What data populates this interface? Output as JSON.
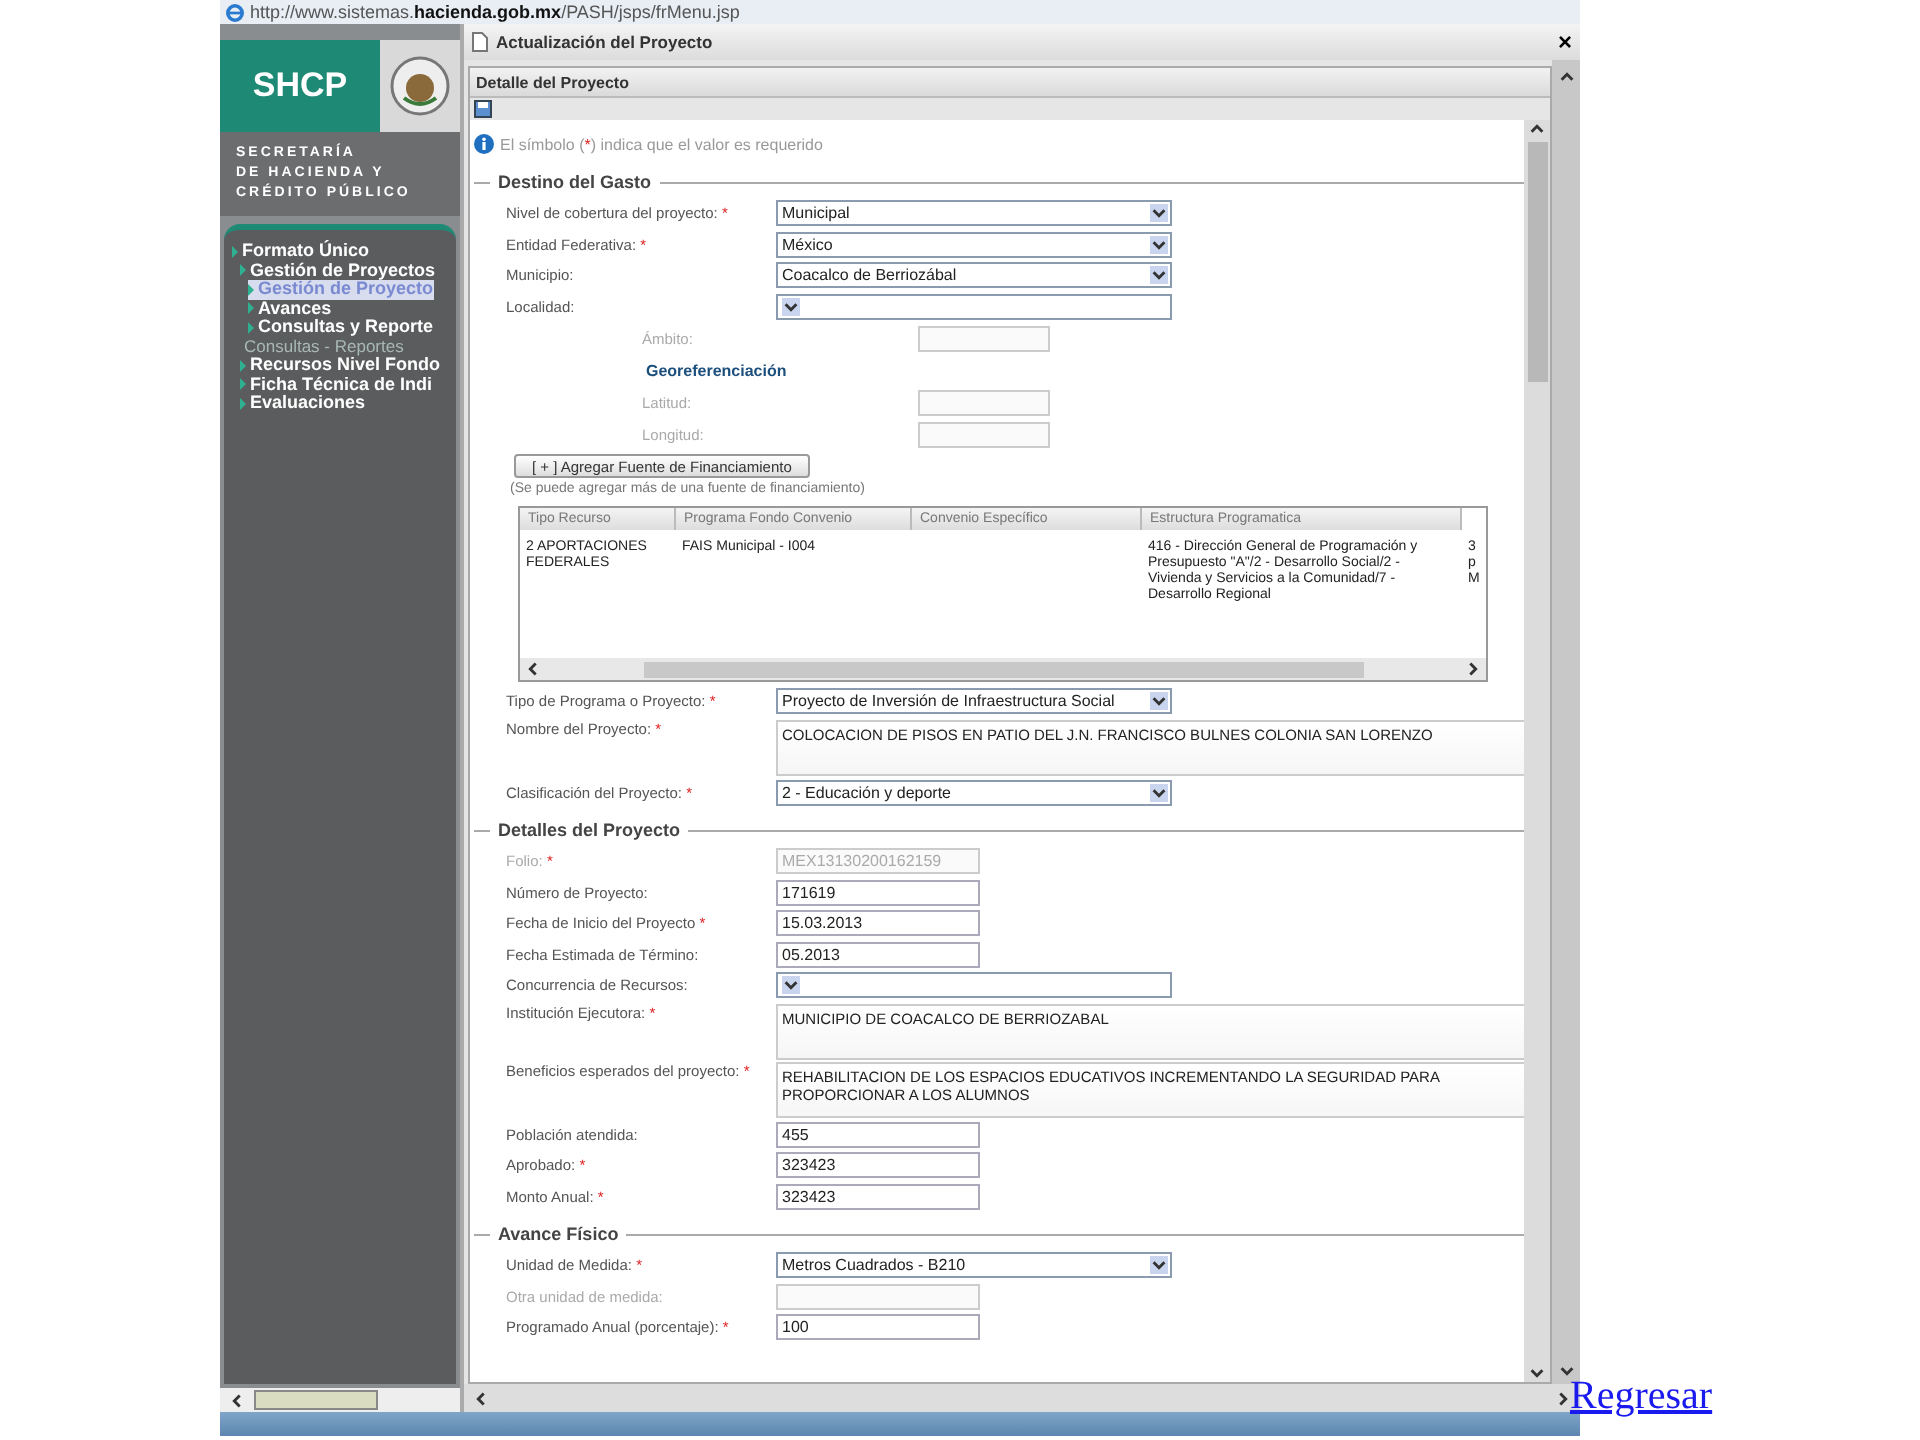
{
  "browser": {
    "url": "http://www.sistemas.**hacienda.gob.mx**/PASH/jsps/frMenu.jsp"
  },
  "sidebar": {
    "logo": "SHCP",
    "agency": [
      "SECRETARÍA",
      "DE HACIENDA Y",
      "CRÉDITO PÚBLICO"
    ],
    "menu": [
      {
        "label": "Formato Único",
        "kind": "link",
        "selected": false,
        "children": [
          {
            "label": "Gestión de Proyectos",
            "kind": "link",
            "selected": false,
            "children": [
              {
                "label": "Gestión de Proyecto",
                "kind": "link",
                "selected": true
              },
              {
                "label": "Avances",
                "kind": "link",
                "selected": false
              },
              {
                "label": "Consultas y Reporte",
                "kind": "link",
                "selected": false
              }
            ]
          },
          {
            "label": "Consultas - Reportes",
            "kind": "section",
            "selected": false
          },
          {
            "label": "Recursos Nivel Fondo",
            "kind": "link",
            "selected": false
          },
          {
            "label": "Ficha Técnica de Indi",
            "kind": "link",
            "selected": false
          },
          {
            "label": "Evaluaciones",
            "kind": "link",
            "selected": false
          }
        ]
      }
    ]
  },
  "dialog": {
    "title": "Actualización del Proyecto",
    "close": "×",
    "panel_title": "Detalle del Proyecto",
    "note": {
      "before": "El símbolo (",
      "mark": "*",
      "after": ") indica que el valor es requerido"
    },
    "sections": [
      {
        "title": "Destino del Gasto",
        "items": [
          {
            "kind": "select",
            "label": "Nivel de cobertura del proyecto:",
            "mark": "*",
            "value": "Municipal"
          },
          {
            "kind": "select",
            "label": "Entidad Federativa:",
            "mark": "*",
            "value": "México"
          },
          {
            "kind": "select",
            "label": "Municipio:",
            "value": "Coacalco de Berriozábal"
          },
          {
            "kind": "select",
            "label": "Localidad:"
          },
          {
            "kind": "subinput",
            "label": "Ámbito:",
            "disabled": true
          },
          {
            "kind": "subheading",
            "label": "Georeferenciación"
          },
          {
            "kind": "subinput",
            "label": "Latitud:",
            "disabled": true
          },
          {
            "kind": "subinput",
            "label": "Longitud:",
            "disabled": true
          },
          {
            "kind": "button",
            "label": "[ + ] Agregar Fuente de Financiamiento"
          },
          {
            "kind": "hint",
            "label": "(Se puede agregar más de una fuente de financiamiento)"
          },
          {
            "kind": "table",
            "columns": [
              "Tipo Recurso",
              "Programa Fondo Convenio",
              "Convenio Específico",
              "Estructura Programatica"
            ],
            "rows": [
              {
                "cells": [
                  "2  APORTACIONES FEDERALES",
                  "FAIS Municipal - I004",
                  null,
                  "416 - Dirección General de Programación y Presupuesto \"A\"/2 - Desarrollo Social/2 - Vivienda y Servicios a la Comunidad/7 - Desarrollo Regional",
                  "3\np\nM"
                ]
              }
            ]
          },
          {
            "kind": "select",
            "label": "Tipo de Programa o Proyecto:",
            "mark": "*",
            "value": "Proyecto de Inversión de Infraestructura Social"
          },
          {
            "kind": "textarea",
            "label": "Nombre del Proyecto:",
            "mark": "*",
            "value": "COLOCACION DE PISOS EN PATIO DEL J.N. FRANCISCO BULNES COLONIA SAN LORENZO"
          },
          {
            "kind": "select",
            "label": "Clasificación del Proyecto:",
            "mark": "*",
            "value": "2 - Educación y deporte"
          }
        ]
      },
      {
        "title": "Detalles del Proyecto",
        "items": [
          {
            "kind": "input",
            "label": "Folio:",
            "mark": "*",
            "value": "MEX13130200162159",
            "disabled": true
          },
          {
            "kind": "input",
            "label": "Número de Proyecto:",
            "value": "171619"
          },
          {
            "kind": "input",
            "label": "Fecha de Inicio del Proyecto",
            "mark": "*",
            "value": "15.03.2013"
          },
          {
            "kind": "input",
            "label": "Fecha Estimada de Término:",
            "value": "05.2013"
          },
          {
            "kind": "select",
            "label": "Concurrencia de Recursos:"
          },
          {
            "kind": "textarea",
            "label": "Institución Ejecutora:",
            "mark": "*",
            "value": "MUNICIPIO DE COACALCO DE BERRIOZABAL"
          },
          {
            "kind": "textarea",
            "label": "Beneficios esperados del proyecto:",
            "mark": "*",
            "value": "REHABILITACION DE LOS ESPACIOS EDUCATIVOS INCREMENTANDO LA SEGURIDAD PARA PROPORCIONAR A LOS ALUMNOS"
          },
          {
            "kind": "input",
            "label": "Población atendida:",
            "value": "455"
          },
          {
            "kind": "input",
            "label": "Aprobado:",
            "mark": "*",
            "value": "323423"
          },
          {
            "kind": "input",
            "label": "Monto Anual:",
            "mark": "*",
            "value": "323423"
          }
        ]
      },
      {
        "title": "Avance Físico",
        "items": [
          {
            "kind": "select",
            "label": "Unidad de Medida:",
            "mark": "*",
            "value": "Metros Cuadrados - B210"
          },
          {
            "kind": "input",
            "label": "Otra unidad de medida:",
            "disabled": true
          },
          {
            "kind": "input",
            "label": "Programado Anual (porcentaje):",
            "mark": "*",
            "value": "100"
          }
        ]
      }
    ]
  },
  "back_link": "Regresar"
}
